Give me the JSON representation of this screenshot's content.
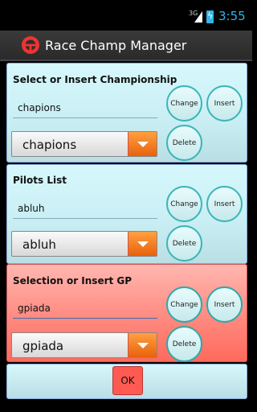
{
  "status": {
    "network": "3G",
    "time": "3:55"
  },
  "app": {
    "title": "Race Champ Manager"
  },
  "championship": {
    "heading": "Select or Insert Championship",
    "input_value": "chapions",
    "spinner_value": "chapions",
    "change_label": "Change",
    "insert_label": "Insert",
    "delete_label": "Delete"
  },
  "pilots": {
    "heading": "Pilots List",
    "input_value": "abluh",
    "spinner_value": "abluh",
    "change_label": "Change",
    "insert_label": "Insert",
    "delete_label": "Delete"
  },
  "gp": {
    "heading": "Selection or Insert GP",
    "input_value": "gpiada",
    "spinner_value": "gpiada",
    "change_label": "Change",
    "insert_label": "Insert",
    "delete_label": "Delete"
  },
  "footer": {
    "ok_label": "OK"
  },
  "colors": {
    "accent": "#33b5e5",
    "panel": "#c8eef3",
    "selected_panel": "#ff8a80",
    "spinner_arrow": "#f07a20"
  }
}
